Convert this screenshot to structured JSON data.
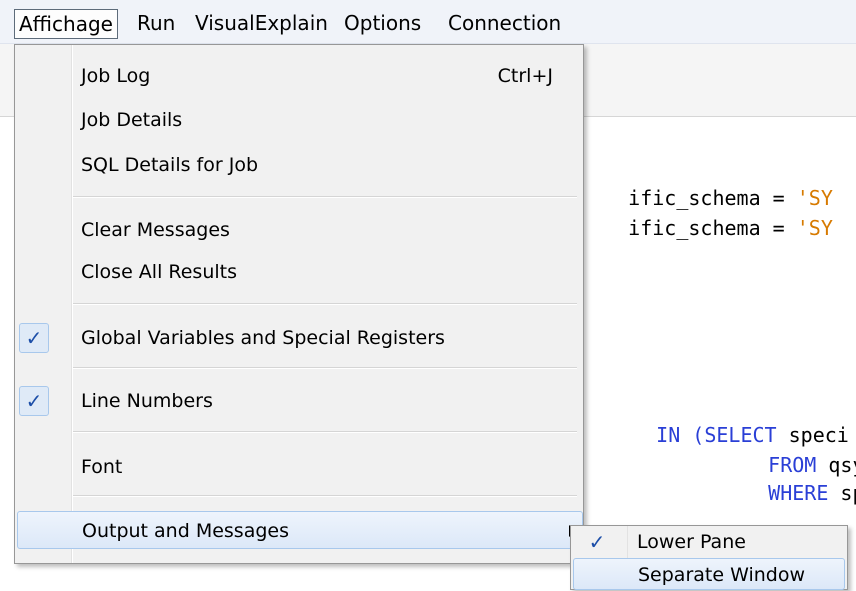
{
  "menubar": {
    "items": [
      "Affichage",
      "Run",
      "VisualExplain",
      "Options",
      "Connection"
    ]
  },
  "editor": {
    "lines": [
      {
        "parts": [
          {
            "t": "ific_schema = ",
            "c": "plain"
          },
          {
            "t": "'SY",
            "c": "str"
          }
        ]
      },
      {
        "parts": [
          {
            "t": "ific_schema = ",
            "c": "plain"
          },
          {
            "t": "'SY",
            "c": "str"
          }
        ]
      },
      {
        "parts": [
          {
            "t": "IN (",
            "c": "kw"
          },
          {
            "t": "SELECT",
            "c": "kw"
          },
          {
            "t": " speci",
            "c": "plain"
          }
        ]
      },
      {
        "parts": [
          {
            "t": "FROM",
            "c": "kw"
          },
          {
            "t": " qsys",
            "c": "plain"
          }
        ]
      },
      {
        "parts": [
          {
            "t": "WHERE",
            "c": "kw"
          },
          {
            "t": " spe",
            "c": "plain"
          }
        ]
      }
    ]
  },
  "menu": {
    "items": {
      "job_log": {
        "label": "Job Log",
        "shortcut": "Ctrl+J"
      },
      "job_details": {
        "label": "Job Details"
      },
      "sql_details": {
        "label": "SQL Details for Job"
      },
      "clear_messages": {
        "label": "Clear Messages"
      },
      "close_all_results": {
        "label": "Close All Results"
      },
      "global_variables": {
        "label": "Global Variables and Special Registers",
        "checked": true
      },
      "line_numbers": {
        "label": "Line Numbers",
        "checked": true
      },
      "font": {
        "label": "Font"
      },
      "output_messages": {
        "label": "Output and Messages",
        "has_submenu": true
      }
    },
    "check_glyph": "✓"
  },
  "submenu": {
    "lower_pane": {
      "label": "Lower Pane",
      "checked": true
    },
    "separate_window": {
      "label": "Separate Window"
    }
  },
  "colors": {
    "keyword": "#2a3fd6",
    "string": "#d77a00",
    "highlight_border": "#a8c8ec",
    "check": "#1c4ea8"
  }
}
